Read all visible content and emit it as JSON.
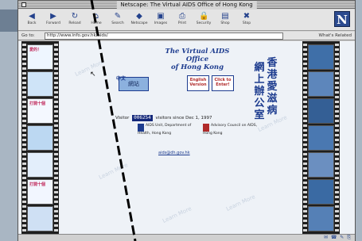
{
  "window": {
    "title": "Netscape: The Virtual AIDS Office of Hong Kong"
  },
  "toolbar": {
    "buttons": [
      {
        "label": "Back",
        "icon": "back-arrow-icon",
        "glyph": "◀"
      },
      {
        "label": "Forward",
        "icon": "forward-arrow-icon",
        "glyph": "▶"
      },
      {
        "label": "Reload",
        "icon": "reload-icon",
        "glyph": "↻"
      },
      {
        "label": "Home",
        "icon": "home-icon",
        "glyph": "⌂"
      },
      {
        "label": "Search",
        "icon": "search-icon",
        "glyph": "✎"
      },
      {
        "label": "Netscape",
        "icon": "netscape-icon",
        "glyph": "◆"
      },
      {
        "label": "Images",
        "icon": "images-icon",
        "glyph": "▣"
      },
      {
        "label": "Print",
        "icon": "print-icon",
        "glyph": "⎙"
      },
      {
        "label": "Security",
        "icon": "security-lock-icon",
        "glyph": "🔒"
      },
      {
        "label": "Shop",
        "icon": "shop-icon",
        "glyph": "▤"
      },
      {
        "label": "Stop",
        "icon": "stop-icon",
        "glyph": "✖"
      }
    ],
    "logo": "N"
  },
  "location": {
    "label": "Go to:",
    "url": "http://www.info.gov.hk/aids/",
    "whats_related": "What's Related"
  },
  "page": {
    "title_line1": "The Virtual AIDS Office",
    "title_line2": "of Hong Kong",
    "cjk_right": [
      "香",
      "港",
      "愛",
      "滋",
      "病"
    ],
    "cjk_left": [
      "網",
      "上",
      "辦",
      "公",
      "室"
    ],
    "btn_chinese_tag": "中文",
    "btn_chinese": "網站",
    "btn_english": "English Version",
    "btn_click": "Click to Enter!",
    "visitor_prefix": "Visitor",
    "visitor_count": "006254",
    "visitor_suffix": "visitors since Dec 1, 1997",
    "org_left": "AIDS Unit, Department of Health, Hong Kong",
    "org_right": "Advisory Council on AIDS, Hong Kong",
    "footer_link": "aids@dh.gov.hk"
  },
  "film": {
    "left_frames": [
      "愛的！",
      "",
      "打開十個",
      "",
      "",
      "打開十個",
      ""
    ],
    "right_frames": [
      "",
      "",
      "",
      "",
      "",
      "",
      ""
    ]
  },
  "status": {
    "text": "",
    "icons": "✉ ☎ ✎ ⎘"
  },
  "colors": {
    "accent": "#1d3c8f",
    "background": "#eef2f7",
    "film": "#1e1e1e"
  }
}
